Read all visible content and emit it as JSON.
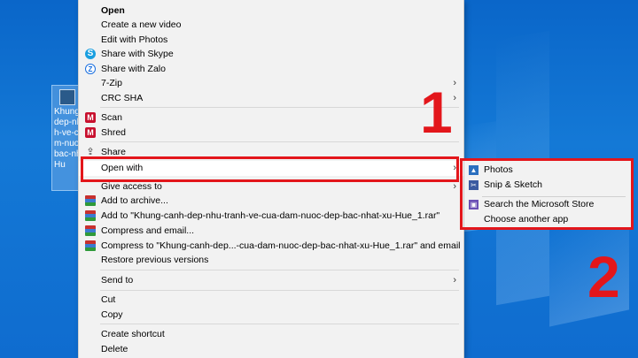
{
  "desktop": {
    "icon_label": "Khung-\ndep-nh\nh-ve-c\nm-nuo\nbac-nh\nHu"
  },
  "menu": {
    "items": [
      {
        "label": "Open",
        "bold": true
      },
      {
        "label": "Create a new video"
      },
      {
        "label": "Edit with Photos"
      },
      {
        "label": "Share with Skype",
        "icon": "skype-icon"
      },
      {
        "label": "Share with Zalo",
        "icon": "zalo-icon"
      },
      {
        "label": "7-Zip",
        "submenu": true
      },
      {
        "label": "CRC SHA",
        "submenu": true
      },
      {
        "label": "Scan",
        "icon": "mcafee-icon"
      },
      {
        "label": "Shred",
        "icon": "mcafee-icon"
      },
      {
        "label": "Share",
        "icon": "share-icon"
      },
      {
        "label": "Open with",
        "submenu": true
      },
      {
        "label": "Give access to",
        "submenu": true
      },
      {
        "label": "Add to archive...",
        "icon": "winrar-icon"
      },
      {
        "label": "Add to \"Khung-canh-dep-nhu-tranh-ve-cua-dam-nuoc-dep-bac-nhat-xu-Hue_1.rar\"",
        "icon": "winrar-icon"
      },
      {
        "label": "Compress and email...",
        "icon": "winrar-icon"
      },
      {
        "label": "Compress to \"Khung-canh-dep...-cua-dam-nuoc-dep-bac-nhat-xu-Hue_1.rar\" and email",
        "icon": "winrar-icon"
      },
      {
        "label": "Restore previous versions"
      },
      {
        "label": "Send to",
        "submenu": true
      },
      {
        "label": "Cut"
      },
      {
        "label": "Copy"
      },
      {
        "label": "Create shortcut"
      },
      {
        "label": "Delete"
      }
    ],
    "chevron": "›"
  },
  "submenu": {
    "items": [
      {
        "label": "Photos",
        "icon": "photos-icon"
      },
      {
        "label": "Snip & Sketch",
        "icon": "snip-sketch-icon"
      },
      {
        "label": "Search the Microsoft Store",
        "icon": "store-icon"
      },
      {
        "label": "Choose another app"
      }
    ]
  },
  "annotations": {
    "step1": "1",
    "step2": "2",
    "color": "#e3161b"
  }
}
